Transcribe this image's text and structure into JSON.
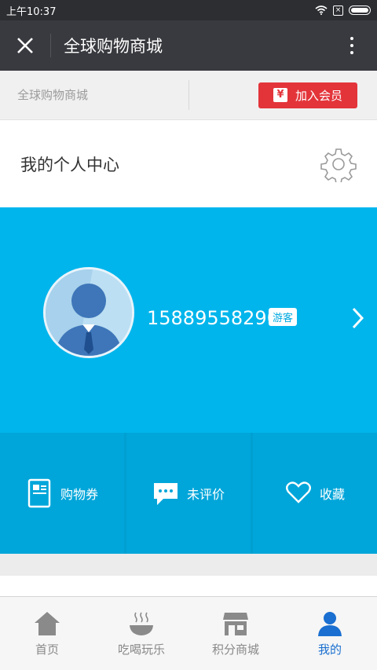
{
  "status_bar": {
    "time": "上午10:37"
  },
  "title_bar": {
    "title": "全球购物商城"
  },
  "shop_header": {
    "name": "全球购物商城",
    "join_label": "加入会员",
    "join_icon": "¥"
  },
  "center": {
    "title": "我的个人中心"
  },
  "profile": {
    "phone": "15889558290",
    "badge": "游客"
  },
  "quick_actions": [
    {
      "label": "购物券",
      "icon": "coupon-icon"
    },
    {
      "label": "未评价",
      "icon": "comment-icon"
    },
    {
      "label": "收藏",
      "icon": "heart-icon"
    }
  ],
  "tabs": [
    {
      "label": "首页",
      "icon": "home-icon",
      "active": false
    },
    {
      "label": "吃喝玩乐",
      "icon": "bowl-icon",
      "active": false
    },
    {
      "label": "积分商城",
      "icon": "store-icon",
      "active": false
    },
    {
      "label": "我的",
      "icon": "user-icon",
      "active": true
    }
  ],
  "colors": {
    "accent_blue": "#00b5ec",
    "tab_active": "#1a6fd0",
    "join_red": "#e3343a"
  }
}
